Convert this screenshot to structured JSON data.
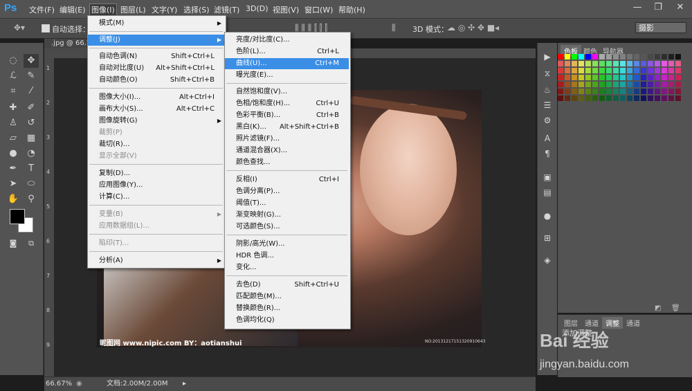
{
  "app": {
    "logo": "Ps"
  },
  "menubar": {
    "items": [
      "文件(F)",
      "编辑(E)",
      "图像(I)",
      "图层(L)",
      "文字(Y)",
      "选择(S)",
      "滤镜(T)",
      "3D(D)",
      "视图(V)",
      "窗口(W)",
      "帮助(H)"
    ],
    "active_index": 2
  },
  "window_controls": {
    "minimize": "—",
    "restore": "❐",
    "close": "✕"
  },
  "options_bar": {
    "auto_select_label": "自动选择：",
    "mode_3d_label": "3D 模式：",
    "workspace": "摄影"
  },
  "document": {
    "tab_title": ".jpg @ 66.7",
    "ruler_left_marks": [
      "1",
      "2",
      "3",
      "4",
      "5",
      "6",
      "7",
      "8",
      "9"
    ],
    "photo_caption": "昵图网 www.nipic.com    BY：aotianshui",
    "photo_id": "NO:20131217151320910643"
  },
  "status_bar": {
    "zoom": "66.67%",
    "doc_info": "文档:2.00M/2.00M"
  },
  "panels": {
    "swatch_tabs": [
      "色板",
      "颜色",
      "导航器"
    ],
    "adjust_tabs": [
      "图层",
      "通道",
      "调整",
      "通道"
    ],
    "adjust_add_label": "添加调整"
  },
  "image_menu": {
    "items": [
      {
        "label": "模式(M)",
        "shortcut": "",
        "submenu": true,
        "disabled": false
      },
      {
        "label": "调整(J)",
        "shortcut": "",
        "submenu": true,
        "disabled": false,
        "open": true
      },
      {
        "label": "自动色调(N)",
        "shortcut": "Shift+Ctrl+L",
        "disabled": false
      },
      {
        "label": "自动对比度(U)",
        "shortcut": "Alt+Shift+Ctrl+L",
        "disabled": false
      },
      {
        "label": "自动颜色(O)",
        "shortcut": "Shift+Ctrl+B",
        "disabled": false
      },
      {
        "label": "图像大小(I)...",
        "shortcut": "Alt+Ctrl+I",
        "disabled": false
      },
      {
        "label": "画布大小(S)...",
        "shortcut": "Alt+Ctrl+C",
        "disabled": false
      },
      {
        "label": "图像旋转(G)",
        "shortcut": "",
        "submenu": true,
        "disabled": false
      },
      {
        "label": "裁剪(P)",
        "shortcut": "",
        "disabled": true
      },
      {
        "label": "裁切(R)...",
        "shortcut": "",
        "disabled": false
      },
      {
        "label": "显示全部(V)",
        "shortcut": "",
        "disabled": true
      },
      {
        "label": "复制(D)...",
        "shortcut": "",
        "disabled": false
      },
      {
        "label": "应用图像(Y)...",
        "shortcut": "",
        "disabled": false
      },
      {
        "label": "计算(C)...",
        "shortcut": "",
        "disabled": false
      },
      {
        "label": "变量(B)",
        "shortcut": "",
        "submenu": true,
        "disabled": true
      },
      {
        "label": "应用数据组(L)...",
        "shortcut": "",
        "disabled": true
      },
      {
        "label": "陷印(T)...",
        "shortcut": "",
        "disabled": true
      },
      {
        "label": "分析(A)",
        "shortcut": "",
        "submenu": true,
        "disabled": false
      }
    ]
  },
  "adjust_menu": {
    "items": [
      {
        "label": "亮度/对比度(C)...",
        "shortcut": ""
      },
      {
        "label": "色阶(L)...",
        "shortcut": "Ctrl+L"
      },
      {
        "label": "曲线(U)...",
        "shortcut": "Ctrl+M",
        "highlighted": true
      },
      {
        "label": "曝光度(E)...",
        "shortcut": ""
      },
      {
        "label": "自然饱和度(V)...",
        "shortcut": ""
      },
      {
        "label": "色相/饱和度(H)...",
        "shortcut": "Ctrl+U"
      },
      {
        "label": "色彩平衡(B)...",
        "shortcut": "Ctrl+B"
      },
      {
        "label": "黑白(K)...",
        "shortcut": "Alt+Shift+Ctrl+B"
      },
      {
        "label": "照片滤镜(F)...",
        "shortcut": ""
      },
      {
        "label": "通道混合器(X)...",
        "shortcut": ""
      },
      {
        "label": "颜色查找...",
        "shortcut": ""
      },
      {
        "label": "反相(I)",
        "shortcut": "Ctrl+I"
      },
      {
        "label": "色调分离(P)...",
        "shortcut": ""
      },
      {
        "label": "阈值(T)...",
        "shortcut": ""
      },
      {
        "label": "渐变映射(G)...",
        "shortcut": ""
      },
      {
        "label": "可选颜色(S)...",
        "shortcut": ""
      },
      {
        "label": "阴影/高光(W)...",
        "shortcut": ""
      },
      {
        "label": "HDR 色调...",
        "shortcut": ""
      },
      {
        "label": "变化...",
        "shortcut": ""
      },
      {
        "label": "去色(D)",
        "shortcut": "Shift+Ctrl+U"
      },
      {
        "label": "匹配颜色(M)...",
        "shortcut": ""
      },
      {
        "label": "替换颜色(R)...",
        "shortcut": ""
      },
      {
        "label": "色调均化(Q)",
        "shortcut": ""
      }
    ]
  },
  "watermark": {
    "brand": "Bai 经验",
    "url": "jingyan.baidu.com"
  },
  "colors": {
    "menu_highlight": "#3a8ee6",
    "app_blue": "#31a8ff"
  }
}
